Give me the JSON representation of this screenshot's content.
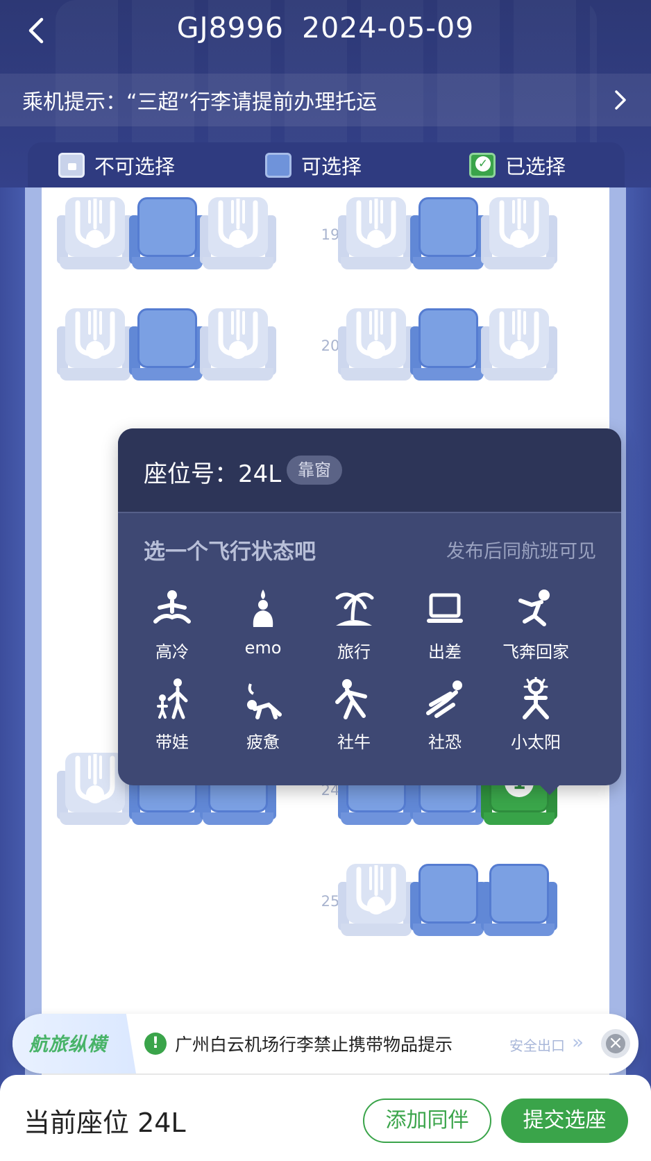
{
  "header": {
    "flight_no": "GJ8996",
    "date": "2024-05-09",
    "notice": "乘机提示：“三超”行李请提前办理托运"
  },
  "legend": [
    {
      "label": "不可选择",
      "icon": "locked-seat-icon"
    },
    {
      "label": "可选择",
      "icon": "available-seat-icon"
    },
    {
      "label": "已选择",
      "icon": "selected-seat-icon"
    }
  ],
  "rows": [
    {
      "number": "19",
      "seats": [
        "occupied",
        "available",
        "occupied",
        "occupied",
        "available",
        "occupied"
      ]
    },
    {
      "number": "20",
      "seats": [
        "occupied",
        "available",
        "occupied",
        "occupied",
        "available",
        "occupied"
      ]
    },
    {
      "number": "24",
      "seats": [
        "occupied",
        "available",
        "available",
        "available",
        "available",
        "selected"
      ]
    },
    {
      "number": "25",
      "seats": [
        "",
        "",
        "",
        "occupied",
        "available",
        "available"
      ]
    }
  ],
  "selected_badge": "1",
  "popup": {
    "seat_label": "座位号：",
    "seat_no": "24L",
    "seat_tag": "靠窗",
    "subtitle": "选一个飞行状态吧",
    "hint": "发布后同航班可见",
    "statuses": [
      {
        "label": "高冷",
        "icon": "meditation-icon"
      },
      {
        "label": "emo",
        "icon": "sad-sitting-icon"
      },
      {
        "label": "旅行",
        "icon": "palm-island-icon"
      },
      {
        "label": "出差",
        "icon": "laptop-icon"
      },
      {
        "label": "飞奔回家",
        "icon": "running-icon"
      },
      {
        "label": "带娃",
        "icon": "parent-child-icon"
      },
      {
        "label": "疲惫",
        "icon": "exhausted-icon"
      },
      {
        "label": "社牛",
        "icon": "confident-pose-icon"
      },
      {
        "label": "社恐",
        "icon": "hiding-icon"
      },
      {
        "label": "小太阳",
        "icon": "sunny-person-icon"
      }
    ]
  },
  "banner": {
    "logo": "航旅纵横",
    "text": "广州白云机场行李禁止携带物品提示",
    "exit_label": "安全出口"
  },
  "footer": {
    "current_seat": "当前座位 24L",
    "add_companion": "添加同伴",
    "submit": "提交选座"
  },
  "colors": {
    "accent_green": "#3aa44a",
    "seat_available": "#7ba0e3",
    "seat_occupied": "#dbe3f4",
    "header_bg": "#2d3875",
    "popup_bg": "#3e4873"
  }
}
